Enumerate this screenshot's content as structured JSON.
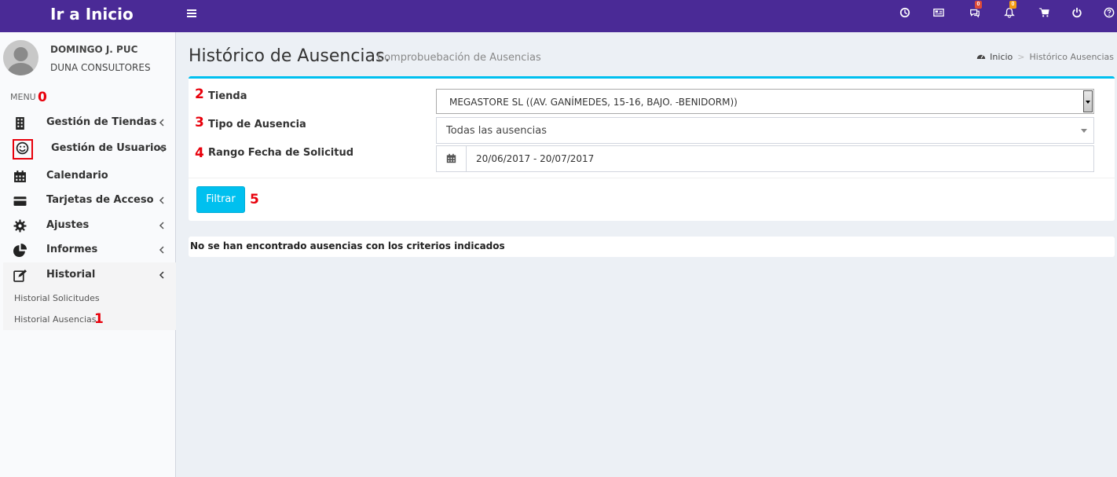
{
  "topbar": {
    "brand": "Ir a Inicio",
    "color": "#4a2a96",
    "icons": [
      {
        "name": "clock-icon"
      },
      {
        "name": "newspaper-icon"
      },
      {
        "name": "comments-icon",
        "badge": "0",
        "badge_color": "#dd4b39"
      },
      {
        "name": "bell-icon",
        "badge": "0",
        "badge_color": "#f39c12"
      },
      {
        "name": "cart-icon"
      },
      {
        "name": "power-icon"
      },
      {
        "name": "help-icon"
      }
    ]
  },
  "user": {
    "name": "DOMINGO J. PUC",
    "company": "DUNA CONSULTORES"
  },
  "sidebar": {
    "menu_header": "MENU",
    "menu_annotation": "0",
    "items": [
      {
        "label": "Gestión de Tiendas",
        "icon": "building-icon"
      },
      {
        "label": "Gestión de Usuarios",
        "icon": "smile-icon"
      },
      {
        "label": "Calendario",
        "icon": "calendar-icon"
      },
      {
        "label": "Tarjetas de Acceso",
        "icon": "credit-card-icon"
      },
      {
        "label": "Ajustes",
        "icon": "gear-icon"
      },
      {
        "label": "Informes",
        "icon": "pie-chart-icon"
      },
      {
        "label": "Historial",
        "icon": "edit-icon"
      }
    ],
    "subitems": [
      {
        "label": "Historial Solicitudes"
      },
      {
        "label": "Historial Ausencias",
        "annotation": "1"
      }
    ]
  },
  "header": {
    "title": "Histórico de Ausencias.",
    "subtitle": "Comprobuebación de Ausencias",
    "breadcrumb": {
      "home": "Inicio",
      "current": "Histórico Ausencias"
    }
  },
  "filters": {
    "tienda": {
      "number": "2",
      "label": "Tienda",
      "value": "MEGASTORE SL ((AV. GANÍMEDES, 15-16, BAJO. -BENIDORM))"
    },
    "tipo": {
      "number": "3",
      "label": "Tipo de Ausencia",
      "value": "Todas las ausencias"
    },
    "rango": {
      "number": "4",
      "label": "Rango Fecha de Solicitud",
      "value": "20/06/2017 - 20/07/2017"
    },
    "button_label": "Filtrar",
    "button_annotation": "5",
    "accent": "#00c0ef"
  },
  "result": {
    "message": "No se han encontrado ausencias con los criterios indicados"
  }
}
